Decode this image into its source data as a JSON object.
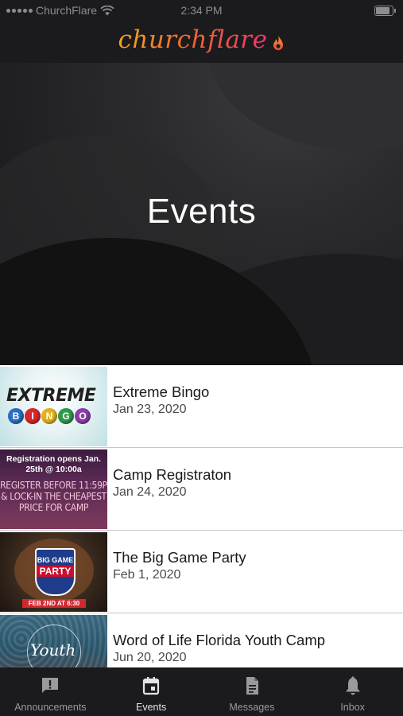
{
  "status_bar": {
    "carrier": "ChurchFlare",
    "time": "2:34 PM"
  },
  "header": {
    "logo_text": "churchflare",
    "logo_icon": "flame-icon"
  },
  "hero": {
    "title": "Events"
  },
  "events": [
    {
      "title": "Extreme Bingo",
      "date": "Jan 23, 2020",
      "thumb_text": "EXTREME",
      "thumb_text2": "BINGO"
    },
    {
      "title": "Camp Registraton",
      "date": "Jan 24, 2020",
      "thumb_text": "Registration opens Jan. 25th @ 10:00a",
      "thumb_text2": "REGISTER BEFORE 11:59P & LOCK-IN THE CHEAPEST PRICE FOR CAMP"
    },
    {
      "title": "The Big Game Party",
      "date": "Feb 1, 2020",
      "thumb_text": "BIG GAME",
      "thumb_text2": "PARTY",
      "thumb_text3": "FEB 2ND AT 6:30"
    },
    {
      "title": "Word of Life Florida Youth Camp",
      "date": "Jun 20, 2020",
      "thumb_text": "Youth"
    }
  ],
  "tabs": [
    {
      "label": "Announcements",
      "icon": "announcement-icon",
      "active": false
    },
    {
      "label": "Events",
      "icon": "calendar-icon",
      "active": true
    },
    {
      "label": "Messages",
      "icon": "document-icon",
      "active": false
    },
    {
      "label": "Inbox",
      "icon": "bell-icon",
      "active": false
    }
  ],
  "colors": {
    "bar_background": "#1b1b1d",
    "logo_gradient_start": "#f6a323",
    "logo_gradient_end": "#e6386e"
  }
}
